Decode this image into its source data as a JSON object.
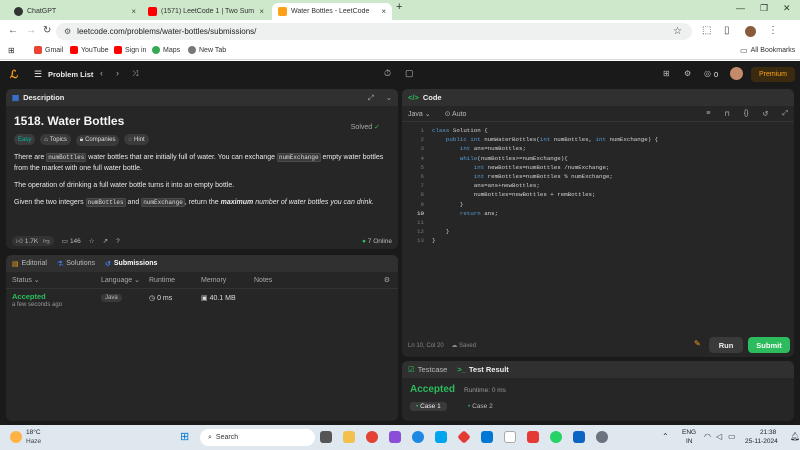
{
  "browser": {
    "tabs": [
      {
        "title": "ChatGPT",
        "color": "#333333"
      },
      {
        "title": "(1571) LeetCode 1 | Two Sum |",
        "color": "#ff0000"
      },
      {
        "title": "Water Bottles - LeetCode",
        "color": "#ffa116"
      }
    ],
    "url": "leetcode.com/problems/water-bottles/submissions/",
    "bookmarks": [
      {
        "label": "Gmail",
        "color": "#ea4335"
      },
      {
        "label": "YouTube",
        "color": "#ff0000"
      },
      {
        "label": "Sign in",
        "color": "#ff0000"
      },
      {
        "label": "Maps",
        "color": "#34a853"
      },
      {
        "label": "New Tab",
        "color": "#555555"
      }
    ],
    "all_bookmarks": "All Bookmarks"
  },
  "nav": {
    "problem_list": "Problem List",
    "coins": "0",
    "premium": "Premium"
  },
  "description": {
    "tab_label": "Description",
    "title": "1518. Water Bottles",
    "solved": "Solved",
    "chips": {
      "difficulty": "Easy",
      "topics": "Topics",
      "companies": "Companies",
      "hint": "Hint"
    },
    "p1_a": "There are ",
    "p1_code1": "numBottles",
    "p1_b": " water bottles that are initially full of water. You can exchange ",
    "p1_code2": "numExchange",
    "p1_c": " empty water bottles from the market with one full water bottle.",
    "p2": "The operation of drinking a full water bottle turns it into an empty bottle.",
    "p3_a": "Given the two integers ",
    "p3_code1": "numBottles",
    "p3_b": " and ",
    "p3_code2": "numExchange",
    "p3_c": ", return the ",
    "p3_em": "maximum",
    "p3_d": " number of water bottles you can drink.",
    "likes": "1.7K",
    "comments": "146",
    "online": "7 Online"
  },
  "submissions": {
    "tabs": [
      "Editorial",
      "Solutions",
      "Submissions"
    ],
    "headers": {
      "status": "Status",
      "language": "Language",
      "runtime": "Runtime",
      "memory": "Memory",
      "notes": "Notes"
    },
    "row": {
      "status": "Accepted",
      "time": "a few seconds ago",
      "language": "Java",
      "runtime": "0 ms",
      "memory": "40.1 MB"
    }
  },
  "code": {
    "tab_label": "Code",
    "language": "Java",
    "auto": "Auto",
    "lines": [
      "class Solution {",
      "    public int numWaterBottles(int numBottles, int numExchange) {",
      "        int ans=numBottles;",
      "        while(numBottles>=numExchange){",
      "            int newBottles=numBottles /numExchange;",
      "            int remBottles=numBottles % numExchange;",
      "            ans=ans+newBottles;",
      "            numBottles=newBottles + remBottles;",
      "        }",
      "        return ans;",
      "",
      "    }",
      "}"
    ],
    "status": "Ln 10, Col 20",
    "saved": "Saved",
    "run": "Run",
    "submit": "Submit"
  },
  "test": {
    "testcase": "Testcase",
    "result_tab": "Test Result",
    "result": "Accepted",
    "runtime": "Runtime: 0 ms",
    "cases": [
      "Case 1",
      "Case 2"
    ]
  },
  "taskbar": {
    "temp": "18°C",
    "weather": "Haze",
    "search": "Search",
    "lang1": "ENG",
    "lang2": "IN",
    "time": "21:38",
    "date": "25-11-2024"
  },
  "colors": {
    "accent": "#ffa116",
    "green": "#2cbb5d",
    "easy": "#00b8a3"
  }
}
